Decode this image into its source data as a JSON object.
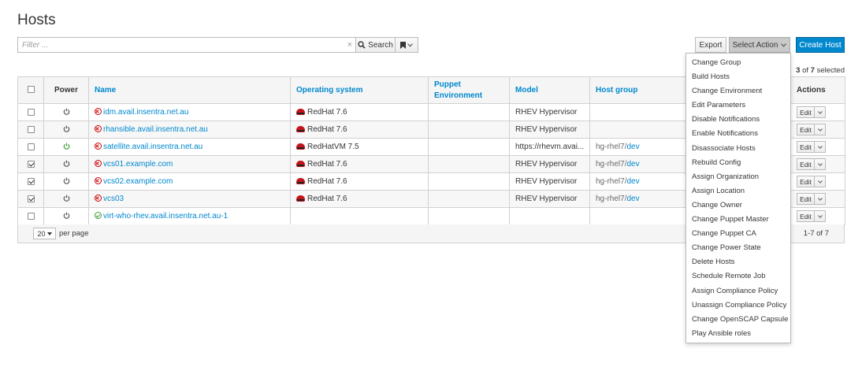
{
  "page": {
    "title": "Hosts"
  },
  "search": {
    "placeholder": "Filter ...",
    "clear_glyph": "×",
    "search_label": "Search",
    "bookmark_icon": "bookmark-icon"
  },
  "toolbar": {
    "export_label": "Export",
    "select_action_label": "Select Action",
    "create_host_label": "Create Host"
  },
  "selection": {
    "selected": "3",
    "total": "7",
    "of_label": "of",
    "selected_label": "selected"
  },
  "table": {
    "headers": {
      "power": "Power",
      "name": "Name",
      "os": "Operating system",
      "puppet": "Puppet Environment",
      "model": "Model",
      "hostgroup": "Host group",
      "actions": "Actions"
    },
    "rows": [
      {
        "checked": false,
        "power": "off",
        "status": "error",
        "name": "idm.avail.insentra.net.au",
        "os": "RedHat 7.6",
        "puppet": "",
        "model": "RHEV Hypervisor",
        "hg_prefix": "",
        "hg_link": "",
        "edit": "Edit"
      },
      {
        "checked": false,
        "power": "off",
        "status": "error",
        "name": "rhansible.avail.insentra.net.au",
        "os": "RedHat 7.6",
        "puppet": "",
        "model": "RHEV Hypervisor",
        "hg_prefix": "",
        "hg_link": "",
        "edit": "Edit"
      },
      {
        "checked": false,
        "power": "on",
        "status": "error",
        "name": "satellite.avail.insentra.net.au",
        "os": "RedHatVM 7.5",
        "puppet": "",
        "model": "https://rhevm.avai...",
        "hg_prefix": "hg-rhel7/",
        "hg_link": "dev",
        "edit": "Edit"
      },
      {
        "checked": true,
        "power": "off",
        "status": "error",
        "name": "vcs01.example.com",
        "os": "RedHat 7.6",
        "puppet": "",
        "model": "RHEV Hypervisor",
        "hg_prefix": "hg-rhel7/",
        "hg_link": "dev",
        "edit": "Edit"
      },
      {
        "checked": true,
        "power": "off",
        "status": "error",
        "name": "vcs02.example.com",
        "os": "RedHat 7.6",
        "puppet": "",
        "model": "RHEV Hypervisor",
        "hg_prefix": "hg-rhel7/",
        "hg_link": "dev",
        "edit": "Edit"
      },
      {
        "checked": true,
        "power": "off",
        "status": "error",
        "name": "vcs03",
        "os": "RedHat 7.6",
        "puppet": "",
        "model": "RHEV Hypervisor",
        "hg_prefix": "hg-rhel7/",
        "hg_link": "dev",
        "edit": "Edit"
      },
      {
        "checked": false,
        "power": "off",
        "status": "ok",
        "name": "virt-who-rhev.avail.insentra.net.au-1",
        "os": "",
        "puppet": "",
        "model": "",
        "hg_prefix": "",
        "hg_link": "",
        "edit": "Edit"
      }
    ]
  },
  "footer": {
    "per_page_value": "20",
    "per_page_label": "per page",
    "pagination": "1-7 of 7"
  },
  "action_menu": {
    "items": [
      "Change Group",
      "Build Hosts",
      "Change Environment",
      "Edit Parameters",
      "Disable Notifications",
      "Enable Notifications",
      "Disassociate Hosts",
      "Rebuild Config",
      "Assign Organization",
      "Assign Location",
      "Change Owner",
      "Change Puppet Master",
      "Change Puppet CA",
      "Change Power State",
      "Delete Hosts",
      "Schedule Remote Job",
      "Assign Compliance Policy",
      "Unassign Compliance Policy",
      "Change OpenSCAP Capsule",
      "Play Ansible roles"
    ]
  },
  "colors": {
    "link": "#0088ce",
    "primary_button": "#0088ce",
    "power_on": "#3f9c35",
    "error": "#cc0000"
  }
}
